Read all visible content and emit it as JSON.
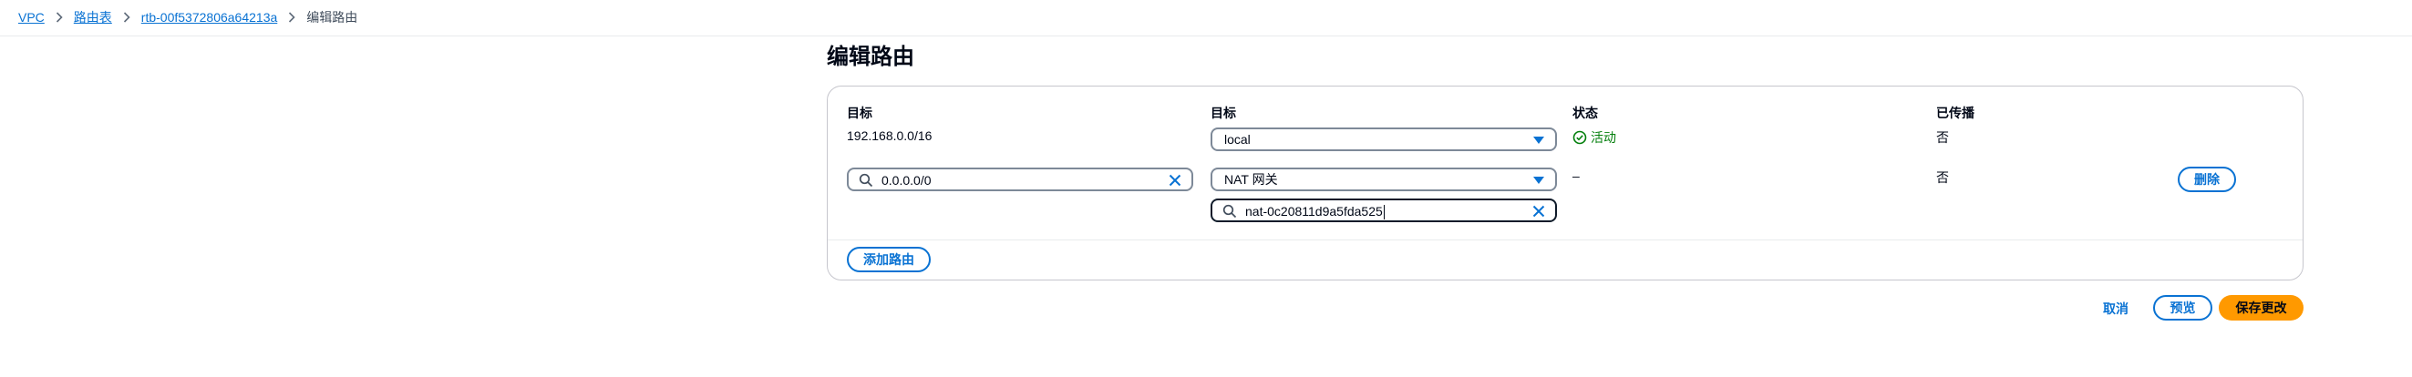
{
  "breadcrumb": {
    "items": [
      "VPC",
      "路由表",
      "rtb-00f5372806a64213a"
    ],
    "current": "编辑路由"
  },
  "page": {
    "title": "编辑路由"
  },
  "table": {
    "headers": {
      "destination": "目标",
      "target": "目标",
      "status": "状态",
      "propagated": "已传播"
    },
    "rows": [
      {
        "destination": "192.168.0.0/16",
        "target": "local",
        "status": "活动",
        "propagated": "否"
      },
      {
        "destination_search": "0.0.0.0/0",
        "target": "NAT 网关",
        "target_search": "nat-0c20811d9a5fda525",
        "status": "–",
        "propagated": "否",
        "remove_label": "删除"
      }
    ]
  },
  "add_route_label": "添加路由",
  "actions": {
    "cancel": "取消",
    "preview": "预览",
    "save": "保存更改"
  },
  "colors": {
    "link": "#0972d3",
    "success": "#037f0c",
    "primary": "#ff9900"
  }
}
